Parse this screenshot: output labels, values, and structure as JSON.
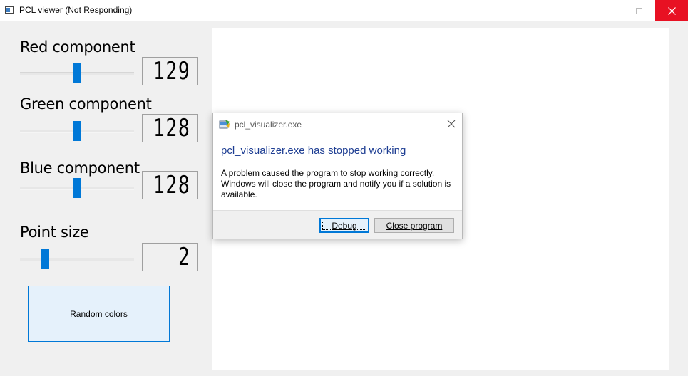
{
  "window": {
    "title": "PCL viewer (Not Responding)",
    "accent_color": "#0078d7",
    "close_button_color": "#e81123"
  },
  "controls": {
    "red": {
      "label": "Red component",
      "value": "129",
      "slider_fraction": 0.5
    },
    "green": {
      "label": "Green component",
      "value": "128",
      "slider_fraction": 0.5
    },
    "blue": {
      "label": "Blue component",
      "value": "128",
      "slider_fraction": 0.5
    },
    "point_size": {
      "label": "Point size",
      "value": "2",
      "slider_fraction": 0.22
    },
    "random_button": "Random colors"
  },
  "dialog": {
    "title": "pcl_visualizer.exe",
    "heading": "pcl_visualizer.exe has stopped working",
    "message": "A problem caused the program to stop working correctly. Windows will close the program and notify you if a solution is available.",
    "heading_color": "#1e3e93",
    "buttons": {
      "debug": "Debug",
      "close_program": "Close program"
    }
  }
}
